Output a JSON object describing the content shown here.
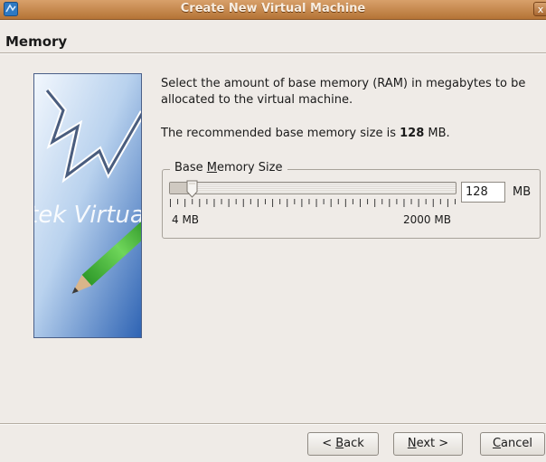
{
  "window": {
    "title": "Create New Virtual Machine",
    "close_glyph": "x"
  },
  "page": {
    "heading": "Memory"
  },
  "side_image": {
    "text": "tek Virtua"
  },
  "content": {
    "description": "Select the amount of base memory (RAM) in megabytes to be allocated to the virtual machine.",
    "recommend_prefix": "The recommended base memory size is ",
    "recommend_value": "128",
    "recommend_suffix": " MB."
  },
  "memory_group": {
    "label_pre": "Base ",
    "label_mnemonic": "M",
    "label_post": "emory Size",
    "slider_min_label": "4 MB",
    "slider_max_label": "2000 MB",
    "slider_min": 4,
    "slider_max": 2000,
    "slider_value": 128,
    "input_value": "128",
    "unit": "MB"
  },
  "buttons": {
    "back": {
      "prefix": "< ",
      "mnemonic": "B",
      "rest": "ack"
    },
    "next": {
      "prefix": "",
      "mnemonic": "N",
      "rest": "ext >"
    },
    "cancel": {
      "prefix": "",
      "mnemonic": "C",
      "rest": "ancel"
    }
  }
}
